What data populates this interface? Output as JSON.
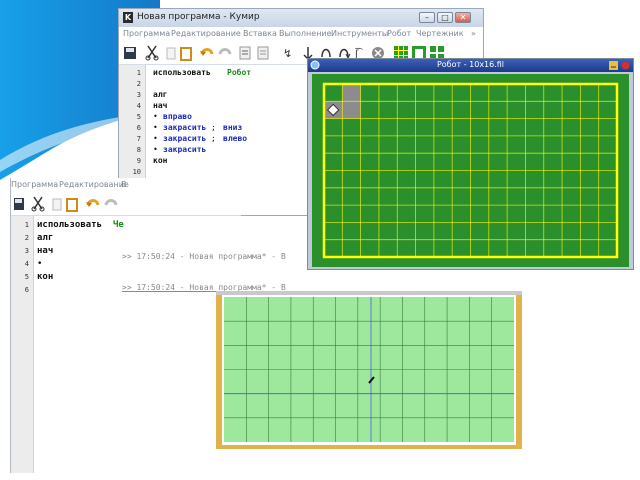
{
  "colors": {
    "accent_blue": "#1a8fd6",
    "robot_field": "#2b8f2b",
    "robot_grid": "#ffff00",
    "turtle_field": "#9ee89e"
  },
  "kumir": {
    "title": "Новая программа - Кумир",
    "menu": [
      "Программа",
      "Редактирование",
      "Вставка",
      "Выполнение",
      "Инструменты",
      "Робот",
      "Чертежник",
      "»"
    ],
    "toolbar_icons": [
      "save-icon",
      "cut-icon",
      "copy-icon",
      "paste-icon",
      "undo-icon",
      "redo-icon",
      "comment-icon",
      "uncomment-icon",
      "run-icon",
      "step-icon",
      "step-in-icon",
      "step-out-icon",
      "stop-icon",
      "robot-field-icon",
      "robot-window-icon",
      "robot-grid-icon"
    ],
    "line_numbers": [
      "1",
      "2",
      "3",
      "4",
      "5",
      "6",
      "7",
      "8",
      "9",
      "10"
    ],
    "code": {
      "l1_kw": "использовать",
      "l1_mod": "Робот",
      "l3": "алг",
      "l4": "нач",
      "l5": "вправо",
      "l6a": "закрасить",
      "l6b": "вниз",
      "l7a": "закрасить",
      "l7b": "влево",
      "l8": "закрасить",
      "l9": "кон",
      "bullet": "•",
      "sep": ";"
    }
  },
  "robot": {
    "title": "Робот - 10x16.fil",
    "cols": 16,
    "rows": 10,
    "painted_cells": [
      [
        1,
        0
      ],
      [
        1,
        1
      ],
      [
        0,
        1
      ]
    ],
    "robot_cell": [
      0,
      1
    ]
  },
  "editor2": {
    "menu": [
      "Программа",
      "Редактирование",
      "В"
    ],
    "line_numbers": [
      "1",
      "2",
      "3",
      "4",
      "5",
      "6"
    ],
    "code": {
      "l1_kw": "использовать",
      "l1_mod": "Че",
      "l2": "алг",
      "l3": "нач",
      "l4": "•",
      "l5": "кон"
    }
  },
  "console": {
    "lines": [
      ">> 17:50:24 - Новая программа* - В",
      ">> 17:50:24 - Новая программа* - В"
    ]
  },
  "turtle": {
    "cols": 13,
    "rows": 6
  }
}
